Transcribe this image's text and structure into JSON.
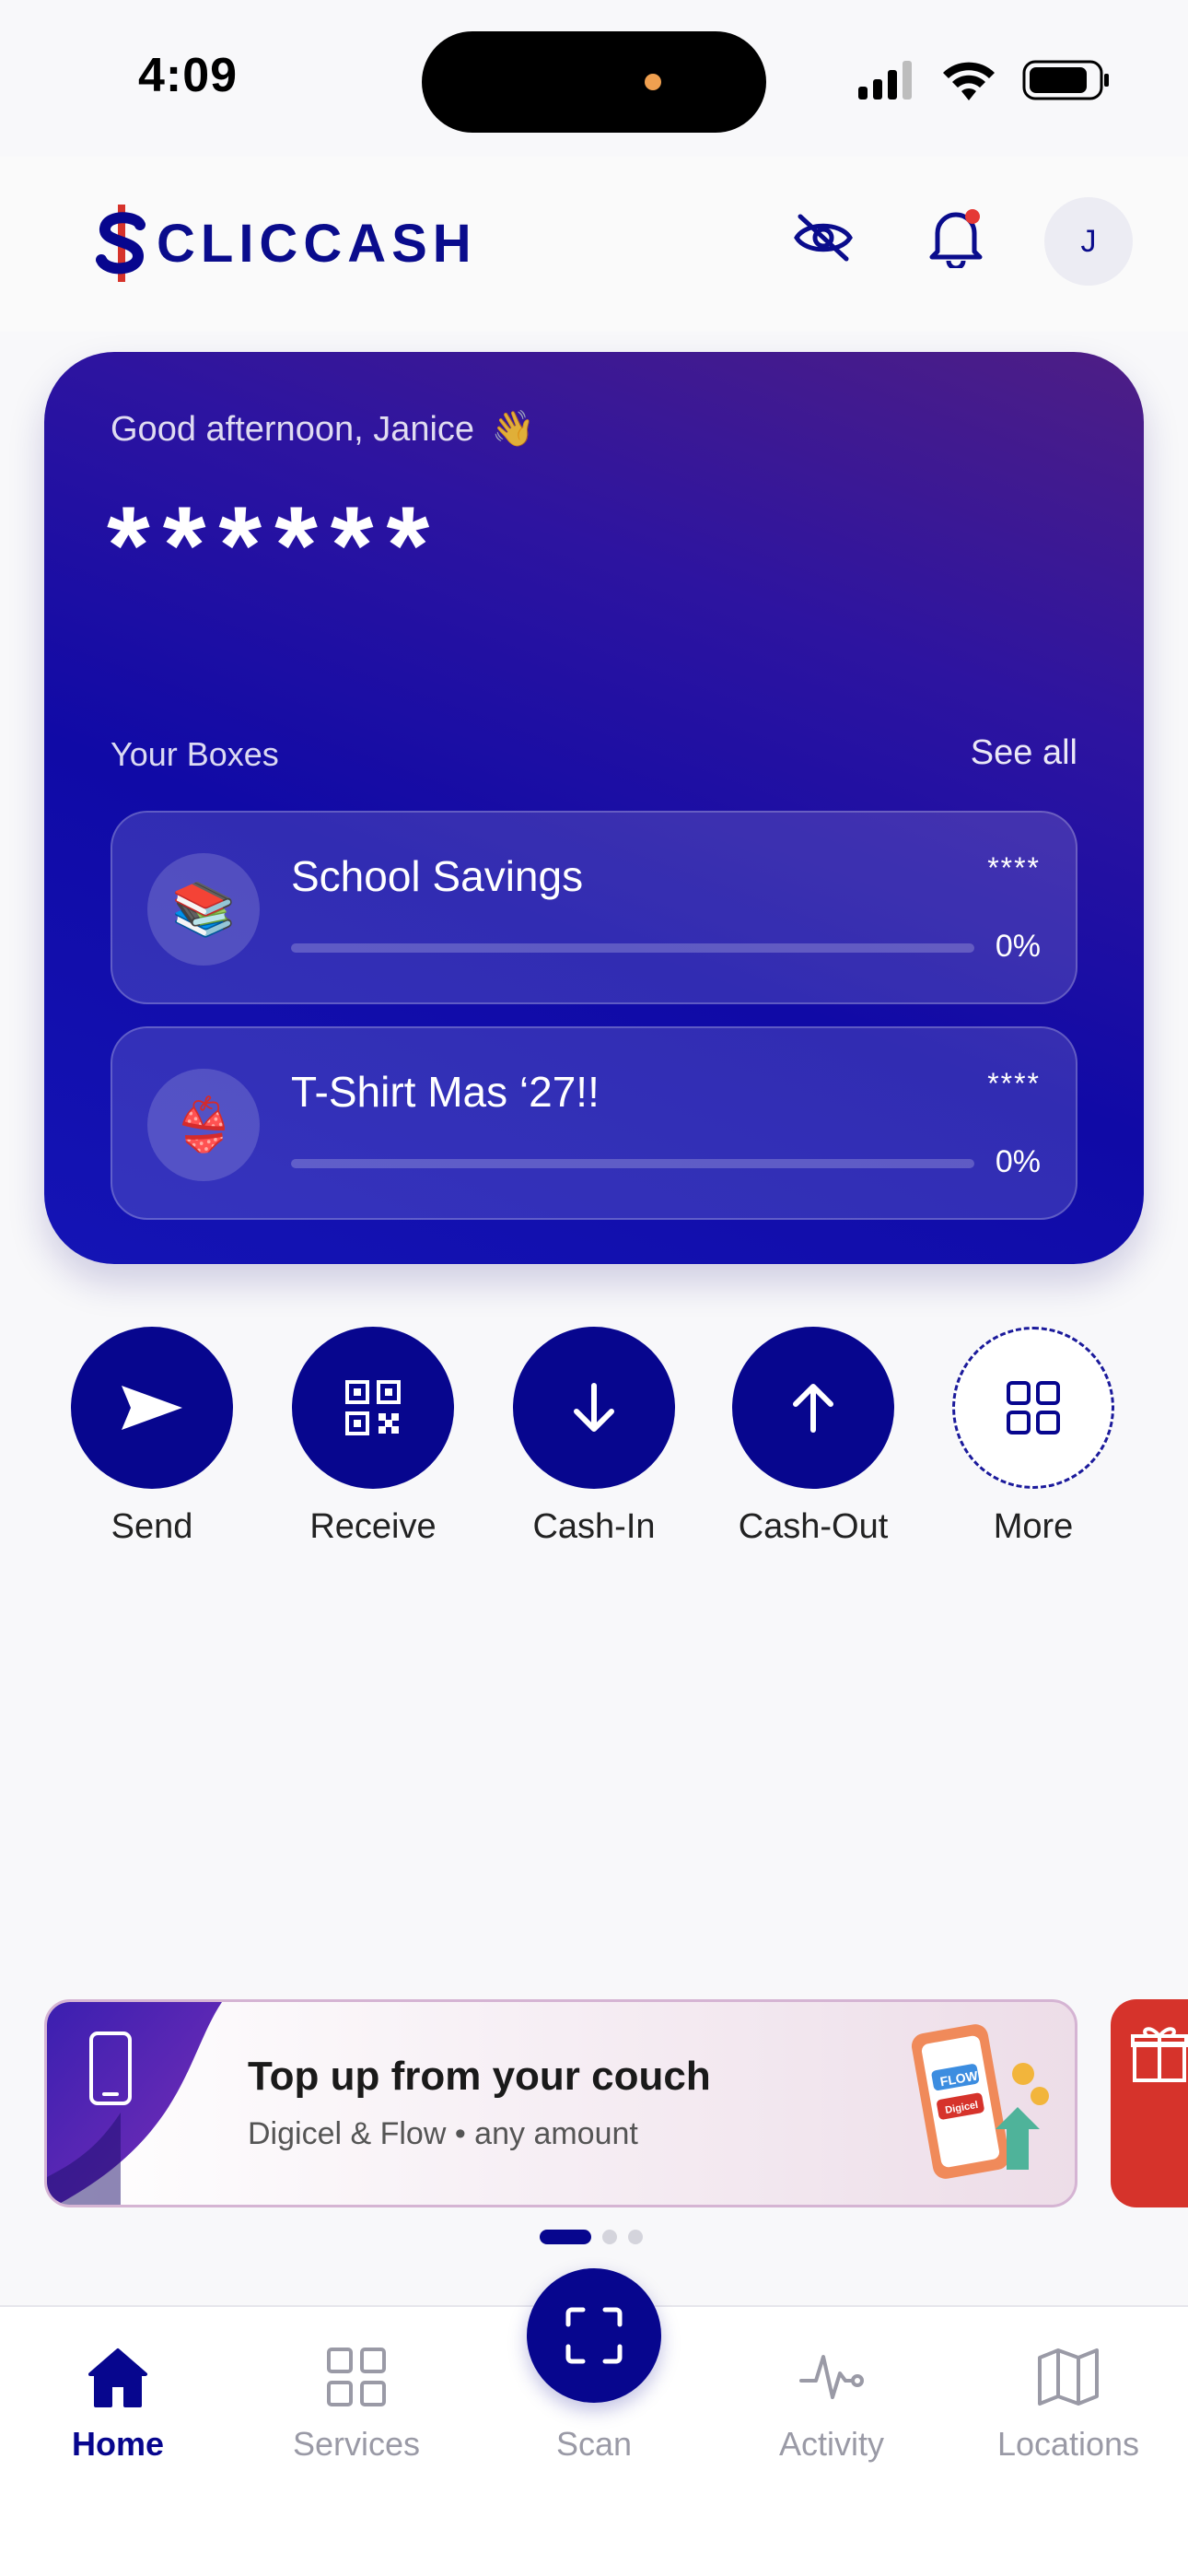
{
  "status_bar": {
    "time": "4:09"
  },
  "header": {
    "logo_text": "CLICCASH",
    "avatar_initial": "J"
  },
  "balance_card": {
    "greeting": "Good afternoon, Janice",
    "greeting_emoji": "👋",
    "balance_masked": "******",
    "boxes_label": "Your Boxes",
    "see_all_label": "See all",
    "boxes": [
      {
        "icon": "books-icon",
        "emoji": "📚",
        "name": "School Savings",
        "amount": "****",
        "progress_label": "0%",
        "progress": 0
      },
      {
        "icon": "bikini-icon",
        "emoji": "👙",
        "name": "T-Shirt Mas ‘27!!",
        "amount": "****",
        "progress_label": "0%",
        "progress": 0
      }
    ]
  },
  "actions": [
    {
      "label": "Send",
      "icon": "send-icon"
    },
    {
      "label": "Receive",
      "icon": "qr-code-icon"
    },
    {
      "label": "Cash-In",
      "icon": "arrow-down-icon"
    },
    {
      "label": "Cash-Out",
      "icon": "arrow-up-icon"
    },
    {
      "label": "More",
      "icon": "grid-icon"
    }
  ],
  "promo": {
    "title": "Top up from your couch",
    "subtitle": "Digicel & Flow • any amount",
    "art_labels": {
      "flow": "FLOW",
      "digicel": "Digicel"
    },
    "carousel_count": 3,
    "carousel_active": 0
  },
  "tabbar": {
    "tabs": [
      {
        "label": "Home",
        "icon": "home-icon",
        "active": true
      },
      {
        "label": "Services",
        "icon": "services-grid-icon",
        "active": false
      },
      {
        "label": "Scan",
        "icon": "scan-icon",
        "active": false
      },
      {
        "label": "Activity",
        "icon": "activity-icon",
        "active": false
      },
      {
        "label": "Locations",
        "icon": "map-icon",
        "active": false
      }
    ]
  },
  "colors": {
    "brand": "#07068e",
    "brand_red": "#d6332b",
    "background": "#f8f8fa"
  }
}
